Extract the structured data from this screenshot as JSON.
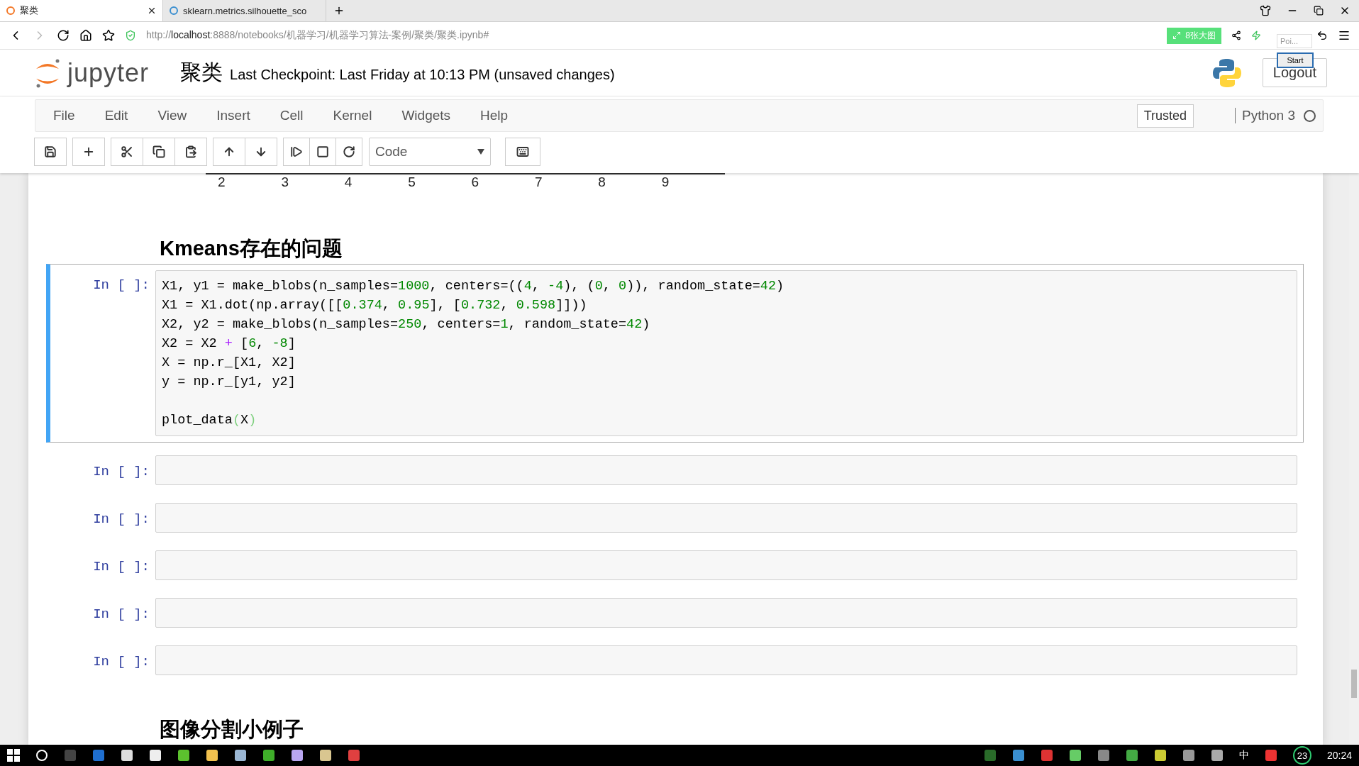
{
  "browser": {
    "tabs": [
      {
        "title": "聚类",
        "selected": true
      },
      {
        "title": "sklearn.metrics.silhouette_sco",
        "selected": false
      }
    ],
    "url": "http://**localhost**:8888/notebooks/机器学习/机器学习算法-案例/聚类/聚类.ipynb#",
    "extension_badge": "8张大图",
    "popup": {
      "field": "Poi...",
      "button": "Start"
    }
  },
  "header": {
    "logo_text": "jupyter",
    "notebook_name": "聚类",
    "checkpoint": "Last Checkpoint: Last Friday at 10:13 PM (unsaved changes)",
    "logout": "Logout"
  },
  "menu": [
    "File",
    "Edit",
    "View",
    "Insert",
    "Cell",
    "Kernel",
    "Widgets",
    "Help"
  ],
  "trusted": "Trusted",
  "kernel": {
    "name": "Python 3",
    "busy": false
  },
  "toolbar": {
    "cell_type": "Code"
  },
  "notebook": {
    "axis_ticks": [
      "2",
      "3",
      "4",
      "5",
      "6",
      "7",
      "8",
      "9"
    ],
    "heading": "Kmeans存在的问题",
    "cells": [
      {
        "prompt": "In [ ]:",
        "selected": true,
        "blocks": [
          {
            "lines": [
              [
                {
                  "kind": "plain",
                  "text": "X1, y1 = make_blobs(n_samples="
                },
                {
                  "kind": "num",
                  "text": "1000"
                },
                {
                  "kind": "plain",
                  "text": ", centers=(("
                },
                {
                  "kind": "num",
                  "text": "4"
                },
                {
                  "kind": "plain",
                  "text": ", "
                },
                {
                  "kind": "num",
                  "text": "-4"
                },
                {
                  "kind": "plain",
                  "text": "), ("
                },
                {
                  "kind": "num",
                  "text": "0"
                },
                {
                  "kind": "plain",
                  "text": ", "
                },
                {
                  "kind": "num",
                  "text": "0"
                },
                {
                  "kind": "plain",
                  "text": ")), random_state="
                },
                {
                  "kind": "num",
                  "text": "42"
                },
                {
                  "kind": "plain",
                  "text": ")"
                }
              ],
              [
                {
                  "kind": "plain",
                  "text": "X1 = X1.dot(np.array([["
                },
                {
                  "kind": "num",
                  "text": "0.374"
                },
                {
                  "kind": "plain",
                  "text": ", "
                },
                {
                  "kind": "num",
                  "text": "0.95"
                },
                {
                  "kind": "plain",
                  "text": "], ["
                },
                {
                  "kind": "num",
                  "text": "0.732"
                },
                {
                  "kind": "plain",
                  "text": ", "
                },
                {
                  "kind": "num",
                  "text": "0.598"
                },
                {
                  "kind": "plain",
                  "text": "]]))"
                }
              ],
              [
                {
                  "kind": "plain",
                  "text": "X2, y2 = make_blobs(n_samples="
                },
                {
                  "kind": "num",
                  "text": "250"
                },
                {
                  "kind": "plain",
                  "text": ", centers="
                },
                {
                  "kind": "num",
                  "text": "1"
                },
                {
                  "kind": "plain",
                  "text": ", random_state="
                },
                {
                  "kind": "num",
                  "text": "42"
                },
                {
                  "kind": "plain",
                  "text": ")"
                }
              ],
              [
                {
                  "kind": "plain",
                  "text": "X2 = X2 "
                },
                {
                  "kind": "op",
                  "text": "+"
                },
                {
                  "kind": "plain",
                  "text": " ["
                },
                {
                  "kind": "num",
                  "text": "6"
                },
                {
                  "kind": "plain",
                  "text": ", "
                },
                {
                  "kind": "num",
                  "text": "-8"
                },
                {
                  "kind": "plain",
                  "text": "]"
                }
              ],
              [
                {
                  "kind": "plain",
                  "text": "X = np.r_[X1, X2]"
                }
              ],
              [
                {
                  "kind": "plain",
                  "text": "y = np.r_[y1, y2]"
                }
              ]
            ]
          },
          {
            "lines": [
              [
                {
                  "kind": "plain",
                  "text": "plot_data"
                },
                {
                  "kind": "match",
                  "text": "("
                },
                {
                  "kind": "plain",
                  "text": "X"
                },
                {
                  "kind": "match",
                  "text": ")"
                }
              ]
            ]
          }
        ]
      },
      {
        "prompt": "In [ ]:",
        "selected": false
      },
      {
        "prompt": "In [ ]:",
        "selected": false
      },
      {
        "prompt": "In [ ]:",
        "selected": false
      },
      {
        "prompt": "In [ ]:",
        "selected": false
      },
      {
        "prompt": "In [ ]:",
        "selected": false
      }
    ],
    "next_heading": "图像分割小例子"
  },
  "taskbar": {
    "ime": "中",
    "badge": "23",
    "clock": "20:24"
  }
}
